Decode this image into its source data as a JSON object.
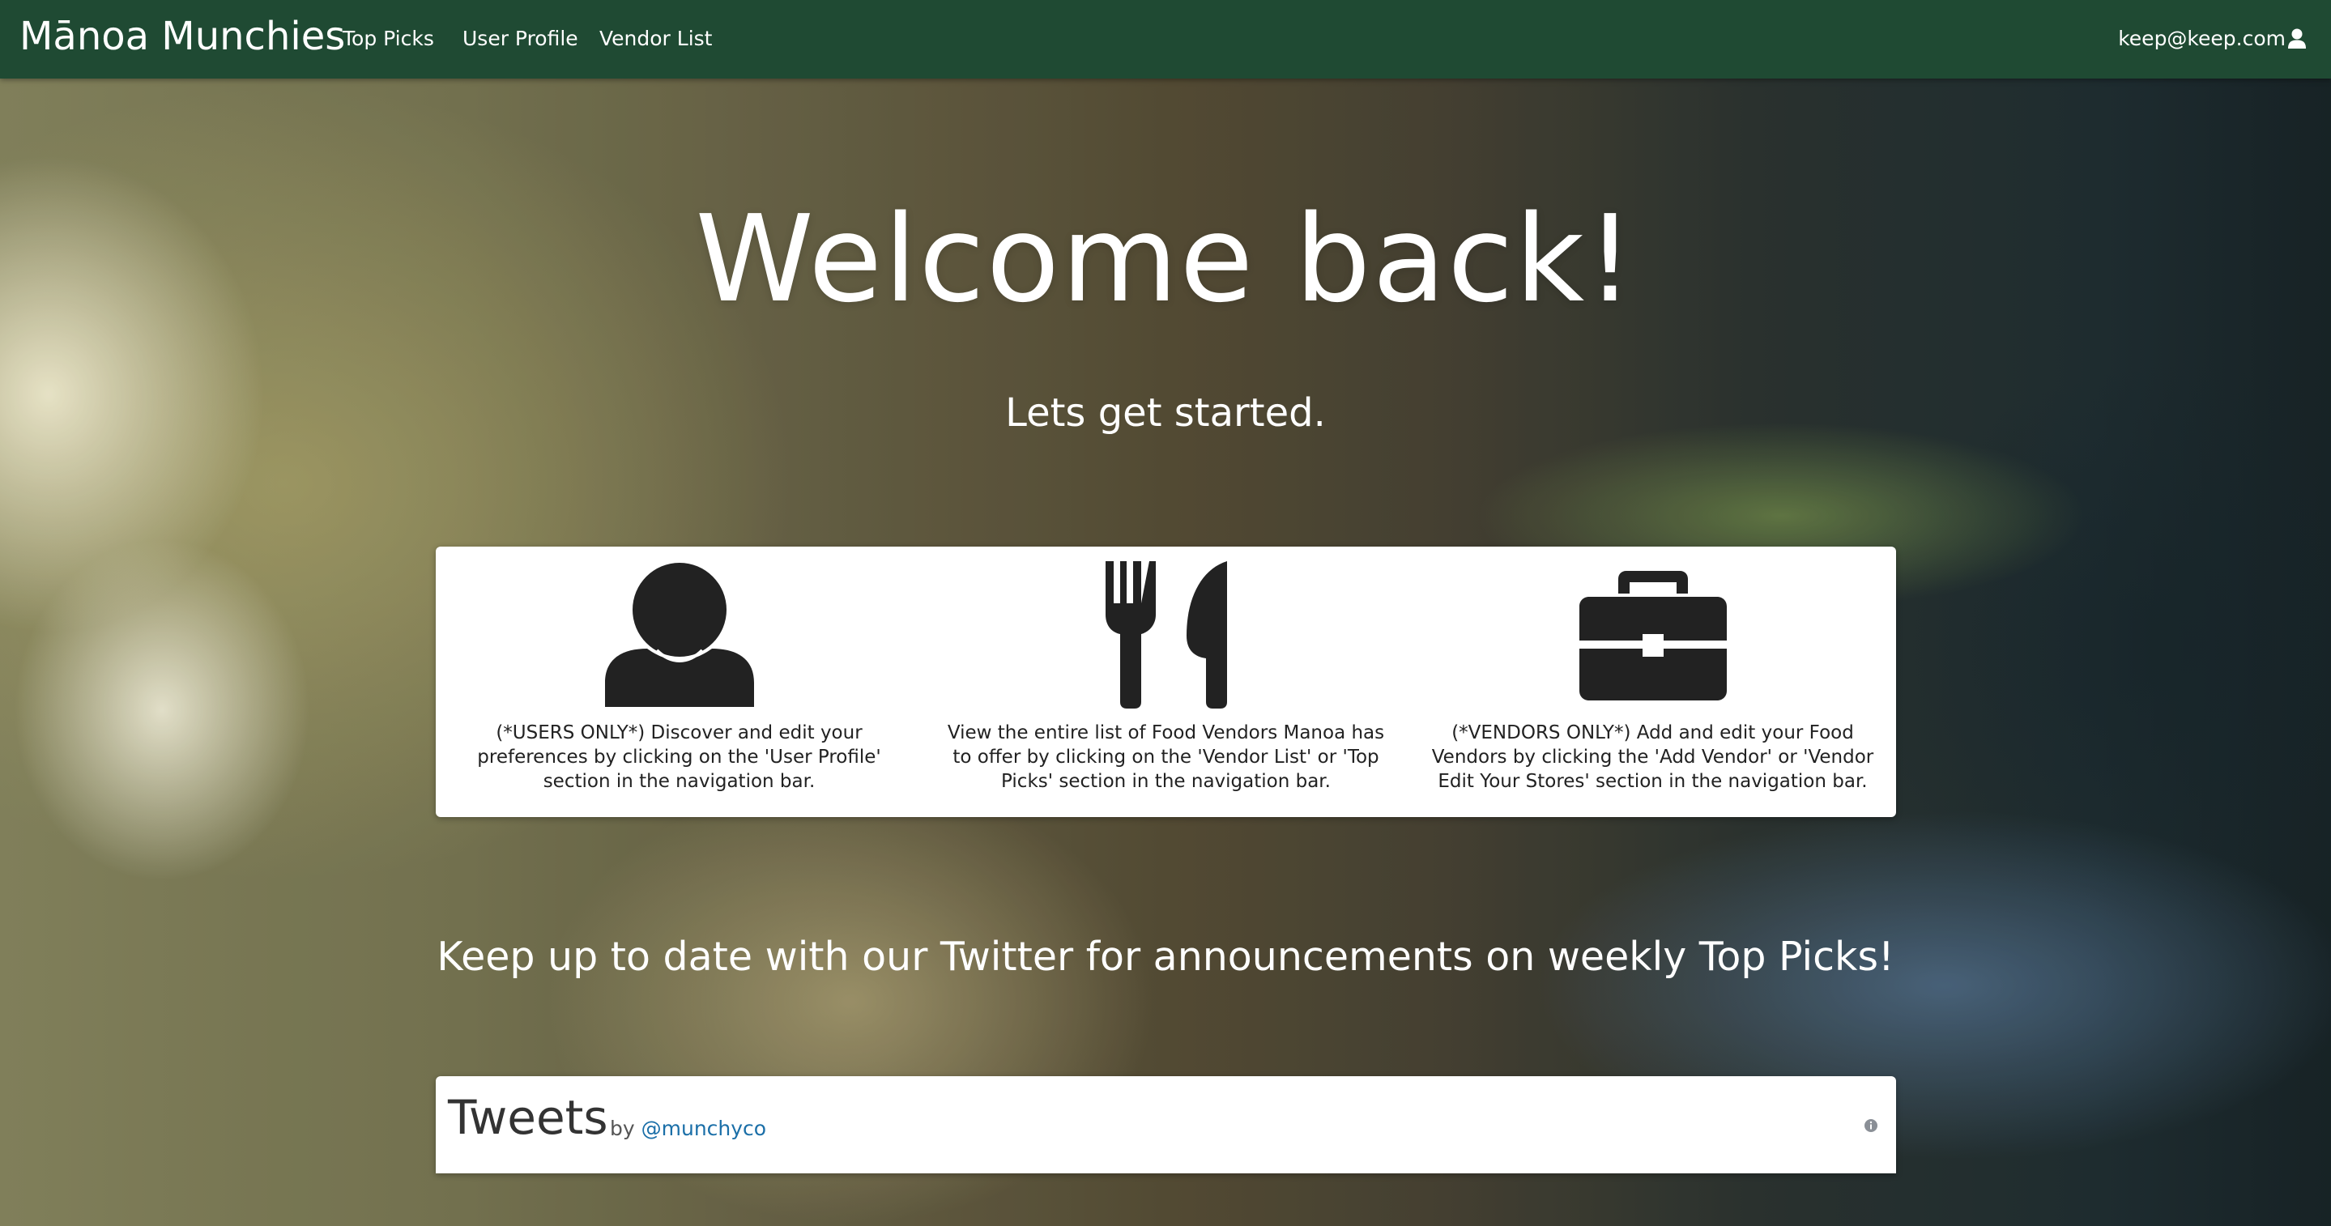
{
  "navbar": {
    "brand": "Mānoa Munchies",
    "links": [
      "Top Picks",
      "User Profile",
      "Vendor List"
    ],
    "user_email": "keep@keep.com",
    "background": "#1f4a33"
  },
  "hero": {
    "title": "Welcome back!",
    "subtitle": "Lets get started.",
    "cards": [
      {
        "icon": "user-icon",
        "text": "(*USERS ONLY*) Discover and edit your preferences by clicking on the 'User Profile' section in the navigation bar."
      },
      {
        "icon": "utensils-icon",
        "text": "View the entire list of Food Vendors Manoa has to offer by clicking on the 'Vendor List' or 'Top Picks' section in the navigation bar."
      },
      {
        "icon": "briefcase-icon",
        "text": "(*VENDORS ONLY*) Add and edit your Food Vendors by clicking the 'Add Vendor' or 'Vendor Edit Your Stores' section in the navigation bar."
      }
    ],
    "twitter_text": "Keep up to date with our Twitter for announcements on weekly Top Picks!"
  },
  "tweets": {
    "title": "Tweets",
    "by": "by",
    "handle": "@munchyco",
    "info_icon": "info-icon"
  }
}
